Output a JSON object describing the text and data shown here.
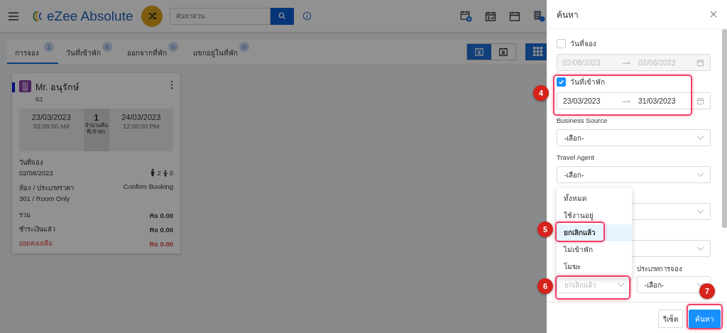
{
  "header": {
    "app_name": "eZee Absolute",
    "search": {
      "placeholder": "ค้นหาด่วน"
    }
  },
  "tabs": [
    {
      "label": "การจอง",
      "count": "1",
      "selected": true
    },
    {
      "label": "วันที่เข้าพัก",
      "count": "0",
      "selected": false
    },
    {
      "label": "ออกจากที่พัก",
      "count": "0",
      "selected": false
    },
    {
      "label": "แขกอยู่ในที่พัก",
      "count": "0",
      "selected": false
    }
  ],
  "view_toggle": [
    {
      "selected": true
    },
    {
      "selected": false
    }
  ],
  "booking_card": {
    "guest": "Mr. อนุรักษ์",
    "number": "83",
    "arrival": {
      "date": "23/03/2023",
      "time": "03:08:00 AM"
    },
    "nights": {
      "count": "1",
      "label": "จำนวนคืนที่เข้าพัก"
    },
    "departure": {
      "date": "24/03/2023",
      "time": "12:00:00 PM"
    },
    "booking_date": {
      "label": "วันที่จอง",
      "value": "02/08/2023"
    },
    "adults": "2",
    "children": "0",
    "room": {
      "label": "ห้อง / ประเภทราคา",
      "value": "301 / Room Only"
    },
    "status": "Confirm Booking",
    "totals": [
      {
        "label": "รวม",
        "amount": "Rs 0.00",
        "kind": "normal"
      },
      {
        "label": "ชำระเงินแล้ว",
        "amount": "Rs 0.00",
        "kind": "normal"
      },
      {
        "label": "ยอดคงเหลือ",
        "amount": "Rs 0.00",
        "kind": "due"
      }
    ]
  },
  "search_panel": {
    "title": "ค้นหา",
    "fields": [
      {
        "kind": "date_range",
        "label": "วันที่จอง",
        "checked": false,
        "from": "02/08/2023",
        "to": "02/08/2023"
      },
      {
        "kind": "date_range",
        "label": "วันที่เข้าพัก",
        "checked": true,
        "from": "23/03/2023",
        "to": "31/03/2023"
      },
      {
        "kind": "select",
        "label": "Business Source",
        "value": "-เลือก-"
      },
      {
        "kind": "select",
        "label": "Travel Agent",
        "value": "-เลือก-"
      },
      {
        "kind": "select"
      },
      {
        "kind": "select"
      }
    ],
    "bottom_row": [
      {
        "placeholder": "ยกเลิกแล้ว",
        "menu": [
          {
            "label": "ทั้งหมด",
            "selected": false
          },
          {
            "label": "ใช้งานอยู่",
            "selected": false
          },
          {
            "label": "ยกเลิกแล้ว",
            "selected": true
          },
          {
            "label": "ไม่เข้าพัก",
            "selected": false
          },
          {
            "label": "โมฆะ",
            "selected": false
          }
        ]
      },
      {
        "label": "ประเภทการจอง",
        "value": "-เลือก-"
      }
    ],
    "buttons": [
      {
        "label": "รีเซ็ต",
        "kind": "secondary"
      },
      {
        "label": "ค้นหา",
        "kind": "primary"
      }
    ]
  },
  "annotations": [
    {
      "number": "4"
    },
    {
      "number": "5"
    },
    {
      "number": "6"
    },
    {
      "number": "7"
    }
  ]
}
